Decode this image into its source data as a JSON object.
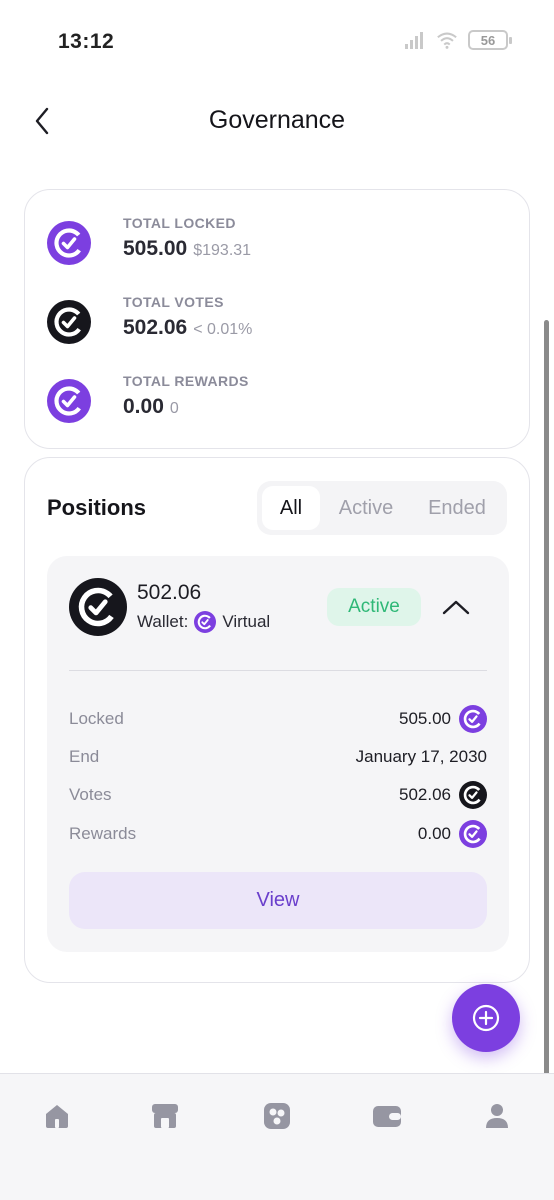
{
  "status_bar": {
    "time": "13:12",
    "battery": "56"
  },
  "header": {
    "title": "Governance"
  },
  "summary": {
    "locked": {
      "label": "TOTAL LOCKED",
      "value": "505.00",
      "sub": "$193.31"
    },
    "votes": {
      "label": "TOTAL VOTES",
      "value": "502.06",
      "sub": "< 0.01%"
    },
    "rewards": {
      "label": "TOTAL REWARDS",
      "value": "0.00",
      "sub": "0"
    }
  },
  "positions": {
    "title": "Positions",
    "tabs": [
      "All",
      "Active",
      "Ended"
    ],
    "active_tab": "All",
    "item": {
      "amount": "502.06",
      "wallet_label": "Wallet:",
      "wallet_name": "Virtual",
      "status": "Active",
      "details": [
        {
          "label": "Locked",
          "value": "505.00",
          "icon": "purple-token-icon"
        },
        {
          "label": "End",
          "value": "January 17, 2030",
          "icon": ""
        },
        {
          "label": "Votes",
          "value": "502.06",
          "icon": "black-token-icon"
        },
        {
          "label": "Rewards",
          "value": "0.00",
          "icon": "purple-token-icon"
        }
      ],
      "view_label": "View"
    }
  },
  "colors": {
    "accent": "#7c3fe0",
    "active_green": "#2fb877",
    "active_bg": "#dff5ea",
    "view_bg": "#ece6f9"
  },
  "bottom_nav": [
    "home-icon",
    "store-icon",
    "apps-icon",
    "wallet-icon",
    "profile-icon"
  ]
}
